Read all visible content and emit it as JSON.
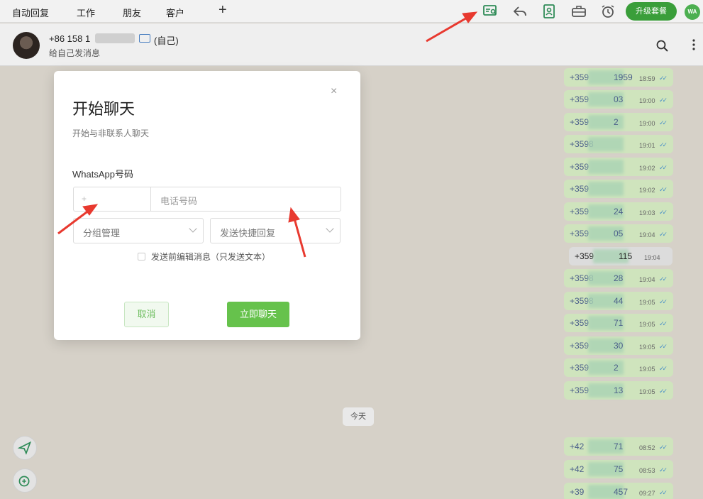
{
  "toolbar": {
    "tabs": [
      "自动回复",
      "工作",
      "朋友",
      "客户"
    ],
    "add_label": "+",
    "upgrade_label": "升级套餐",
    "wa_badge": "WA",
    "icons": [
      "new-chat-icon",
      "reply-icon",
      "contacts-icon",
      "toolbox-icon",
      "alarm-icon"
    ]
  },
  "chat": {
    "contact_phone": "+86 158 1",
    "self_tag": "(自己)",
    "subtitle": "给自己发消息"
  },
  "messages": [
    {
      "prefix": "+359",
      "suffix": "1959",
      "time": "18:59",
      "incoming": false
    },
    {
      "prefix": "+359",
      "suffix": "03",
      "time": "19:00",
      "incoming": false
    },
    {
      "prefix": "+359",
      "suffix": "2",
      "time": "19:00",
      "incoming": false
    },
    {
      "prefix": "+3598",
      "suffix": "",
      "time": "19:01",
      "incoming": false
    },
    {
      "prefix": "+359",
      "suffix": "",
      "time": "19:02",
      "incoming": false
    },
    {
      "prefix": "+359",
      "suffix": "",
      "time": "19:02",
      "incoming": false
    },
    {
      "prefix": "+359",
      "suffix": "24",
      "time": "19:03",
      "incoming": false
    },
    {
      "prefix": "+359",
      "suffix": "05",
      "time": "19:04",
      "incoming": false
    },
    {
      "prefix": "+359",
      "suffix": "115",
      "time": "19:04",
      "incoming": true
    },
    {
      "prefix": "+3598",
      "suffix": "28",
      "time": "19:04",
      "incoming": false
    },
    {
      "prefix": "+3598",
      "suffix": "44",
      "time": "19:05",
      "incoming": false
    },
    {
      "prefix": "+359",
      "suffix": "71",
      "time": "19:05",
      "incoming": false
    },
    {
      "prefix": "+359",
      "suffix": "30",
      "time": "19:05",
      "incoming": false
    },
    {
      "prefix": "+359",
      "suffix": "2",
      "time": "19:05",
      "incoming": false
    },
    {
      "prefix": "+359",
      "suffix": "13",
      "time": "19:05",
      "incoming": false
    },
    {
      "prefix": "+42",
      "suffix": "71",
      "time": "08:52",
      "incoming": false
    },
    {
      "prefix": "+42",
      "suffix": "75",
      "time": "08:53",
      "incoming": false
    },
    {
      "prefix": "+39",
      "suffix": "457",
      "time": "09:27",
      "incoming": false
    }
  ],
  "date_divider": "今天",
  "modal": {
    "close": "×",
    "title": "开始聊天",
    "subtitle": "开始与非联系人聊天",
    "field_label": "WhatsApp号码",
    "code_placeholder": "+",
    "phone_placeholder": "电话号码",
    "group_select": "分组管理",
    "quick_reply_select": "发送快捷回复",
    "checkbox_label": "发送前编辑消息（只发送文本）",
    "cancel_label": "取消",
    "start_label": "立即聊天"
  },
  "colors": {
    "accent": "#66c24c",
    "upgrade": "#3a9e3a",
    "outgoing_bubble": "#cfe4bd",
    "annotation_arrow": "#e8392f"
  }
}
